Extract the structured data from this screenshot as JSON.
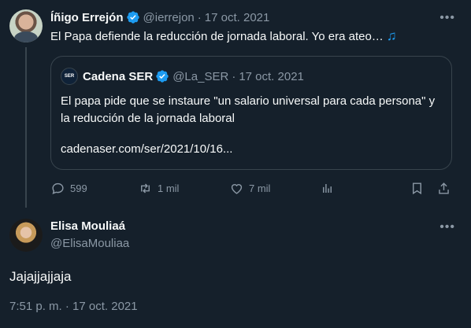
{
  "tweet": {
    "author_name": "Íñigo Errejón",
    "handle": "@ierrejon",
    "separator": "·",
    "date": "17 oct. 2021",
    "text": "El Papa defiende la reducción de jornada laboral. Yo era ateo…",
    "emoji_icon": "music-notes-icon",
    "quote": {
      "logo_text": "SER",
      "author_name": "Cadena SER",
      "handle": "@La_SER",
      "date": "17 oct. 2021",
      "text": "El papa pide que se instaure \"un salario universal para cada persona\" y la reducción de la jornada laboral",
      "link": "cadenaser.com/ser/2021/10/16..."
    },
    "actions": {
      "replies": "599",
      "retweets": "1 mil",
      "likes": "7 mil"
    }
  },
  "reply": {
    "author_name": "Elisa Mouliaá",
    "handle": "@ElisaMouliaa",
    "text": "Jajajjajjaja",
    "timestamp": "7:51 p. m. · 17 oct. 2021"
  },
  "colors": {
    "background": "#15202b",
    "text": "#f7f9f9",
    "muted": "#8b98a5",
    "border": "#38444d",
    "accent": "#1d9bf0"
  }
}
